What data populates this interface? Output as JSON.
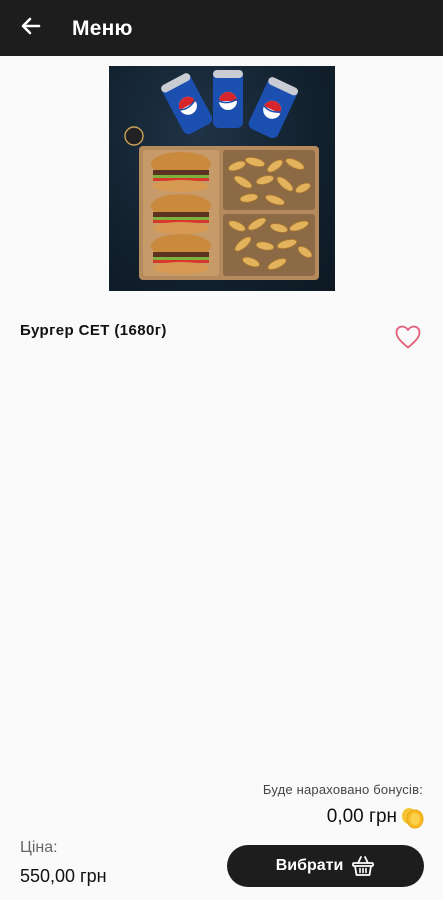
{
  "header": {
    "title": "Меню",
    "back_icon": "arrow-left-icon"
  },
  "product": {
    "image_alt": "burger-set-photo",
    "name": "Бургер СЕТ (1680г)",
    "favorite_icon": "heart-outline-icon"
  },
  "bonus": {
    "label": "Буде нараховано бонусів:",
    "value": "0,00 грн",
    "icon": "coin-icon"
  },
  "price": {
    "label": "Ціна:",
    "value": "550,00 грн"
  },
  "actions": {
    "choose_label": "Вибрати",
    "choose_icon": "basket-icon"
  },
  "colors": {
    "topbar": "#1d1d1d",
    "accent_heart": "#e0607a",
    "coin": "#f5c531",
    "button": "#1d1d1d"
  }
}
